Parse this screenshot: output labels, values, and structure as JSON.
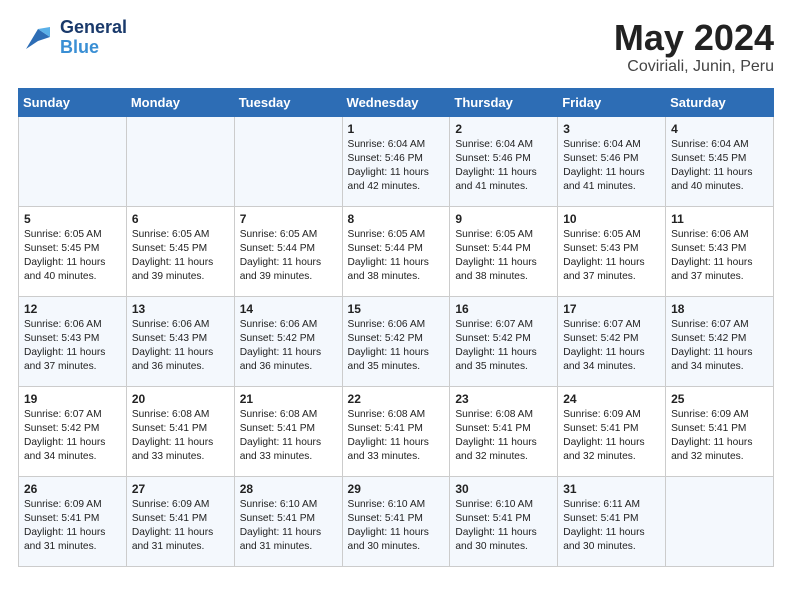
{
  "header": {
    "logo_general": "General",
    "logo_blue": "Blue",
    "month": "May 2024",
    "location": "Coviriali, Junin, Peru"
  },
  "days_of_week": [
    "Sunday",
    "Monday",
    "Tuesday",
    "Wednesday",
    "Thursday",
    "Friday",
    "Saturday"
  ],
  "weeks": [
    [
      {
        "day": "",
        "info": ""
      },
      {
        "day": "",
        "info": ""
      },
      {
        "day": "",
        "info": ""
      },
      {
        "day": "1",
        "info": "Sunrise: 6:04 AM\nSunset: 5:46 PM\nDaylight: 11 hours\nand 42 minutes."
      },
      {
        "day": "2",
        "info": "Sunrise: 6:04 AM\nSunset: 5:46 PM\nDaylight: 11 hours\nand 41 minutes."
      },
      {
        "day": "3",
        "info": "Sunrise: 6:04 AM\nSunset: 5:46 PM\nDaylight: 11 hours\nand 41 minutes."
      },
      {
        "day": "4",
        "info": "Sunrise: 6:04 AM\nSunset: 5:45 PM\nDaylight: 11 hours\nand 40 minutes."
      }
    ],
    [
      {
        "day": "5",
        "info": "Sunrise: 6:05 AM\nSunset: 5:45 PM\nDaylight: 11 hours\nand 40 minutes."
      },
      {
        "day": "6",
        "info": "Sunrise: 6:05 AM\nSunset: 5:45 PM\nDaylight: 11 hours\nand 39 minutes."
      },
      {
        "day": "7",
        "info": "Sunrise: 6:05 AM\nSunset: 5:44 PM\nDaylight: 11 hours\nand 39 minutes."
      },
      {
        "day": "8",
        "info": "Sunrise: 6:05 AM\nSunset: 5:44 PM\nDaylight: 11 hours\nand 38 minutes."
      },
      {
        "day": "9",
        "info": "Sunrise: 6:05 AM\nSunset: 5:44 PM\nDaylight: 11 hours\nand 38 minutes."
      },
      {
        "day": "10",
        "info": "Sunrise: 6:05 AM\nSunset: 5:43 PM\nDaylight: 11 hours\nand 37 minutes."
      },
      {
        "day": "11",
        "info": "Sunrise: 6:06 AM\nSunset: 5:43 PM\nDaylight: 11 hours\nand 37 minutes."
      }
    ],
    [
      {
        "day": "12",
        "info": "Sunrise: 6:06 AM\nSunset: 5:43 PM\nDaylight: 11 hours\nand 37 minutes."
      },
      {
        "day": "13",
        "info": "Sunrise: 6:06 AM\nSunset: 5:43 PM\nDaylight: 11 hours\nand 36 minutes."
      },
      {
        "day": "14",
        "info": "Sunrise: 6:06 AM\nSunset: 5:42 PM\nDaylight: 11 hours\nand 36 minutes."
      },
      {
        "day": "15",
        "info": "Sunrise: 6:06 AM\nSunset: 5:42 PM\nDaylight: 11 hours\nand 35 minutes."
      },
      {
        "day": "16",
        "info": "Sunrise: 6:07 AM\nSunset: 5:42 PM\nDaylight: 11 hours\nand 35 minutes."
      },
      {
        "day": "17",
        "info": "Sunrise: 6:07 AM\nSunset: 5:42 PM\nDaylight: 11 hours\nand 34 minutes."
      },
      {
        "day": "18",
        "info": "Sunrise: 6:07 AM\nSunset: 5:42 PM\nDaylight: 11 hours\nand 34 minutes."
      }
    ],
    [
      {
        "day": "19",
        "info": "Sunrise: 6:07 AM\nSunset: 5:42 PM\nDaylight: 11 hours\nand 34 minutes."
      },
      {
        "day": "20",
        "info": "Sunrise: 6:08 AM\nSunset: 5:41 PM\nDaylight: 11 hours\nand 33 minutes."
      },
      {
        "day": "21",
        "info": "Sunrise: 6:08 AM\nSunset: 5:41 PM\nDaylight: 11 hours\nand 33 minutes."
      },
      {
        "day": "22",
        "info": "Sunrise: 6:08 AM\nSunset: 5:41 PM\nDaylight: 11 hours\nand 33 minutes."
      },
      {
        "day": "23",
        "info": "Sunrise: 6:08 AM\nSunset: 5:41 PM\nDaylight: 11 hours\nand 32 minutes."
      },
      {
        "day": "24",
        "info": "Sunrise: 6:09 AM\nSunset: 5:41 PM\nDaylight: 11 hours\nand 32 minutes."
      },
      {
        "day": "25",
        "info": "Sunrise: 6:09 AM\nSunset: 5:41 PM\nDaylight: 11 hours\nand 32 minutes."
      }
    ],
    [
      {
        "day": "26",
        "info": "Sunrise: 6:09 AM\nSunset: 5:41 PM\nDaylight: 11 hours\nand 31 minutes."
      },
      {
        "day": "27",
        "info": "Sunrise: 6:09 AM\nSunset: 5:41 PM\nDaylight: 11 hours\nand 31 minutes."
      },
      {
        "day": "28",
        "info": "Sunrise: 6:10 AM\nSunset: 5:41 PM\nDaylight: 11 hours\nand 31 minutes."
      },
      {
        "day": "29",
        "info": "Sunrise: 6:10 AM\nSunset: 5:41 PM\nDaylight: 11 hours\nand 30 minutes."
      },
      {
        "day": "30",
        "info": "Sunrise: 6:10 AM\nSunset: 5:41 PM\nDaylight: 11 hours\nand 30 minutes."
      },
      {
        "day": "31",
        "info": "Sunrise: 6:11 AM\nSunset: 5:41 PM\nDaylight: 11 hours\nand 30 minutes."
      },
      {
        "day": "",
        "info": ""
      }
    ]
  ]
}
